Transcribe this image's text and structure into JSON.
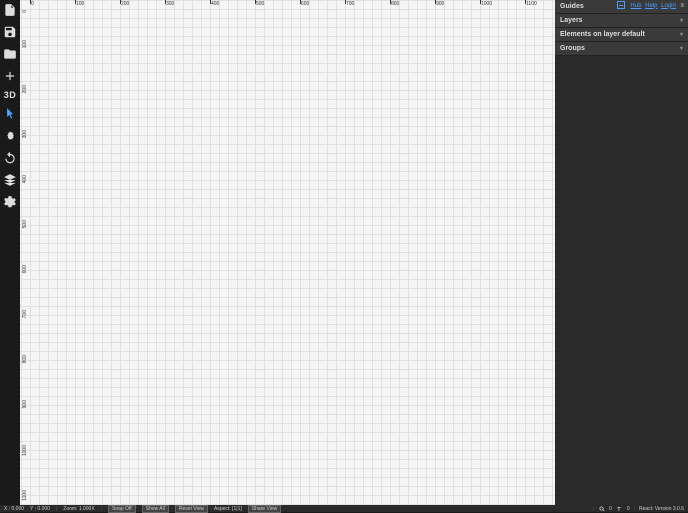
{
  "toolbar": {
    "mode3d": "3D"
  },
  "ruler": {
    "top": [
      "0",
      "100",
      "200",
      "300",
      "400",
      "500",
      "600",
      "700",
      "800",
      "900",
      "1000",
      "1100"
    ],
    "left": [
      "0",
      "100",
      "200",
      "300",
      "400",
      "500",
      "600",
      "700",
      "800",
      "900",
      "1000",
      "1100"
    ]
  },
  "panels": {
    "guides": "Guides",
    "layers": "Layers",
    "elements": "Elements on layer default",
    "groups": "Groups"
  },
  "top_links": {
    "hub": "Hub",
    "help": "Help",
    "login": "Login"
  },
  "status": {
    "x": "X : 0.000",
    "y": "Y : 0.000",
    "zoom": "Zoom: 1.000X",
    "snap_off": "Snap Off",
    "show_all": "Show All",
    "reset_view": "Reset View",
    "aspect": "Aspect: [1|1]",
    "share_view": "Share View",
    "search_count": "0",
    "text_count": "0",
    "version": "React: Version 3.0.6"
  }
}
